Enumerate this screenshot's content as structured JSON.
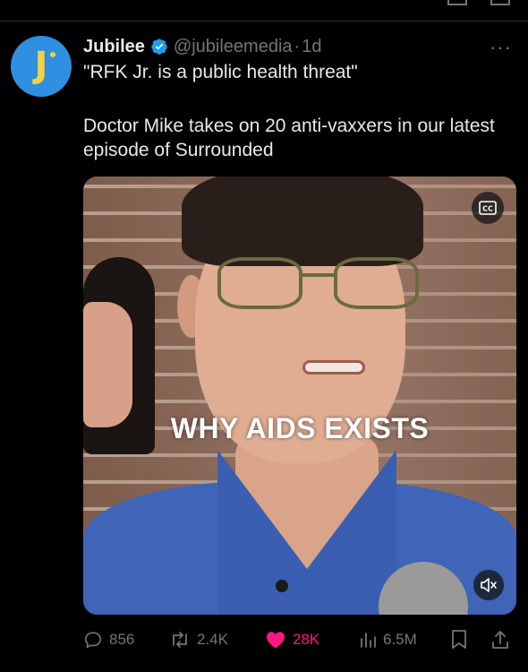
{
  "tweet": {
    "author_name": "Jubilee",
    "handle": "@jubileemedia",
    "separator": "·",
    "time": "1d",
    "avatar_letter": "J",
    "line1": "\"RFK Jr. is a public health threat\"",
    "line2": "Doctor Mike takes on 20 anti-vaxxers in our latest episode of Surrounded"
  },
  "media": {
    "caption": "WHY AIDS EXISTS",
    "cc_label": "CC"
  },
  "actions": {
    "replies": "856",
    "reposts": "2.4K",
    "likes": "28K",
    "views": "6.5M"
  },
  "colors": {
    "background": "#000000",
    "verified": "#1d9bf0",
    "like": "#f91880",
    "muted_text": "#71767b",
    "avatar_bg": "#2f8fe0",
    "avatar_fg": "#f7d23e"
  },
  "icons": [
    "verified-badge-icon",
    "more-icon",
    "cc-icon",
    "mute-icon",
    "reply-icon",
    "repost-icon",
    "like-icon",
    "views-icon",
    "bookmark-icon",
    "share-icon"
  ]
}
